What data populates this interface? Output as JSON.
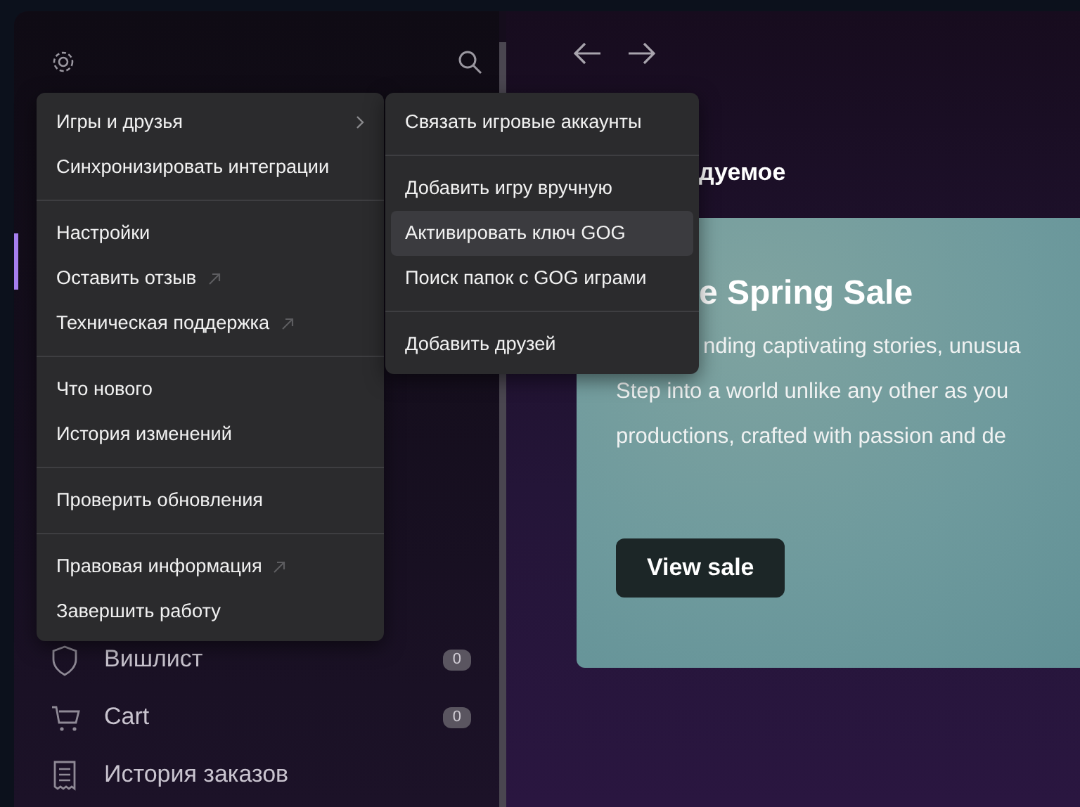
{
  "sidebar": {
    "nav_items": [
      {
        "kind": "wishlist",
        "label": "Вишлист",
        "count": "0"
      },
      {
        "kind": "cart",
        "label": "Cart",
        "count": "0"
      },
      {
        "kind": "orders",
        "label": "История заказов"
      }
    ]
  },
  "main": {
    "heading": "дуемое",
    "banner": {
      "title": "e Spring Sale",
      "lines": [
        "nding captivating stories, unusua",
        "Step into a world unlike any other as you",
        "productions, crafted with passion and de"
      ],
      "button": "View sale"
    }
  },
  "menu": {
    "groups": [
      [
        {
          "label": "Игры и друзья",
          "kind": "submenu"
        },
        {
          "label": "Синхронизировать интеграции",
          "kind": "plain"
        }
      ],
      [
        {
          "label": "Настройки",
          "kind": "plain"
        },
        {
          "label": "Оставить отзыв",
          "kind": "external"
        },
        {
          "label": "Техническая поддержка",
          "kind": "external"
        }
      ],
      [
        {
          "label": "Что нового",
          "kind": "plain"
        },
        {
          "label": "История изменений",
          "kind": "plain"
        }
      ],
      [
        {
          "label": "Проверить обновления",
          "kind": "plain"
        }
      ],
      [
        {
          "label": "Правовая информация",
          "kind": "external"
        },
        {
          "label": "Завершить работу",
          "kind": "plain"
        }
      ]
    ]
  },
  "submenu": {
    "groups": [
      [
        {
          "label": "Связать игровые аккаунты",
          "selected": false
        }
      ],
      [
        {
          "label": "Добавить игру вручную",
          "selected": false
        },
        {
          "label": "Активировать ключ GOG",
          "selected": true
        },
        {
          "label": "Поиск папок с GOG играми",
          "selected": false
        }
      ],
      [
        {
          "label": "Добавить друзей",
          "selected": false
        }
      ]
    ]
  }
}
